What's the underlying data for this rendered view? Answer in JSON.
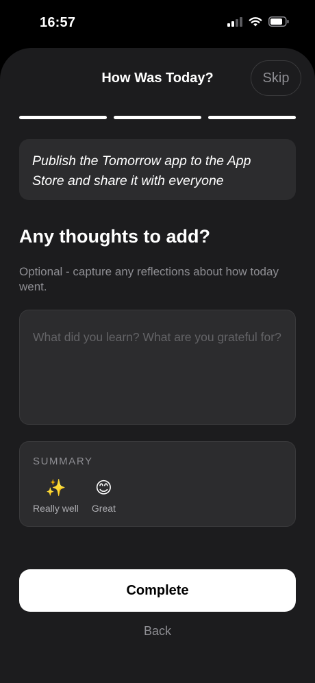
{
  "status_bar": {
    "time": "16:57",
    "icons": [
      "cellular-signal-icon",
      "wifi-icon",
      "battery-icon"
    ]
  },
  "header": {
    "title": "How Was Today?",
    "skip_label": "Skip"
  },
  "progress": {
    "steps_total": 3,
    "steps_completed": 3
  },
  "goal": {
    "text": "Publish the Tomorrow app to the App Store and share it with everyone"
  },
  "thoughts": {
    "heading": "Any thoughts to add?",
    "subtitle": "Optional - capture any reflections about how today went.",
    "value": "",
    "placeholder": "What did you learn? What are you grateful for?"
  },
  "summary": {
    "label": "SUMMARY",
    "items": [
      {
        "emoji": "✨",
        "label": "Really well"
      },
      {
        "emoji": "😊",
        "label": "Great"
      }
    ]
  },
  "actions": {
    "complete_label": "Complete",
    "back_label": "Back"
  },
  "colors": {
    "background": "#1c1c1e",
    "card": "#2c2c2e",
    "secondary_text": "#8e8e93",
    "primary_button": "#ffffff"
  }
}
